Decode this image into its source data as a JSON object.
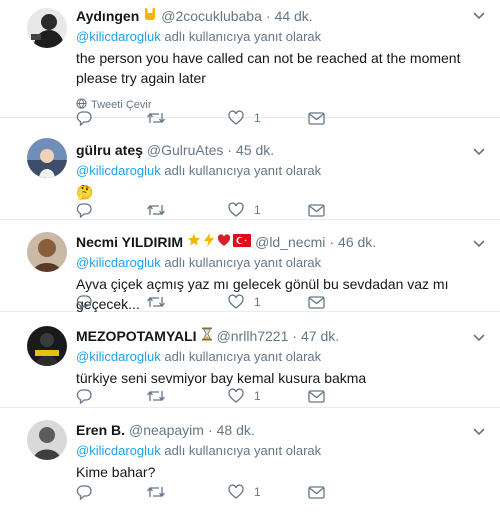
{
  "ui": {
    "reply_to_suffix": "adlı kullanıcıya yanıt olarak",
    "translate_label": "Tweeti Çevir"
  },
  "tweets": [
    {
      "name": "Aydıngen",
      "badges": [
        "rock-hand-emoji"
      ],
      "handle": "@2cocuklubaba",
      "separator": "·",
      "time": "44 dk.",
      "reply_to": "@kilicdarogluk",
      "text": "the person you have called can not be reached at the moment please try again later",
      "translate": true,
      "counts": {
        "reply": "",
        "retweet": "",
        "like": "1",
        "dm": ""
      }
    },
    {
      "name": "gülru ateş",
      "badges": [],
      "handle": "@GulruAtes",
      "separator": "·",
      "time": "45 dk.",
      "reply_to": "@kilicdarogluk",
      "text": "🤔",
      "translate": false,
      "counts": {
        "reply": "",
        "retweet": "",
        "like": "1",
        "dm": ""
      }
    },
    {
      "name": "Necmi YILDIRIM",
      "badges": [
        "star-emoji",
        "lightning-emoji",
        "heart-emoji",
        "turkish-flag-emoji"
      ],
      "handle": "@ld_necmi",
      "separator": "·",
      "time": "46 dk.",
      "reply_to": "@kilicdarogluk",
      "text": "Ayva çiçek açmış yaz mı gelecek gönül bu sevdadan vaz mı geçecek...",
      "translate": false,
      "counts": {
        "reply": "",
        "retweet": "",
        "like": "1",
        "dm": ""
      }
    },
    {
      "name": "MEZOPOTAMYALI",
      "badges": [
        "hourglass-emoji"
      ],
      "handle": "@nrllh7221",
      "separator": "·",
      "time": "47 dk.",
      "reply_to": "@kilicdarogluk",
      "text": "türkiye seni sevmiyor bay kemal kusura bakma",
      "translate": false,
      "counts": {
        "reply": "",
        "retweet": "",
        "like": "1",
        "dm": ""
      }
    },
    {
      "name": "Eren B.",
      "badges": [],
      "handle": "@neapayim",
      "separator": "·",
      "time": "48 dk.",
      "reply_to": "@kilicdarogluk",
      "text": "Kime bahar?",
      "translate": false,
      "counts": {
        "reply": "",
        "retweet": "",
        "like": "1",
        "dm": ""
      }
    }
  ],
  "colors": {
    "accent": "#1da1f2",
    "secondary_text": "#657786",
    "divider": "#e6ecf0"
  }
}
